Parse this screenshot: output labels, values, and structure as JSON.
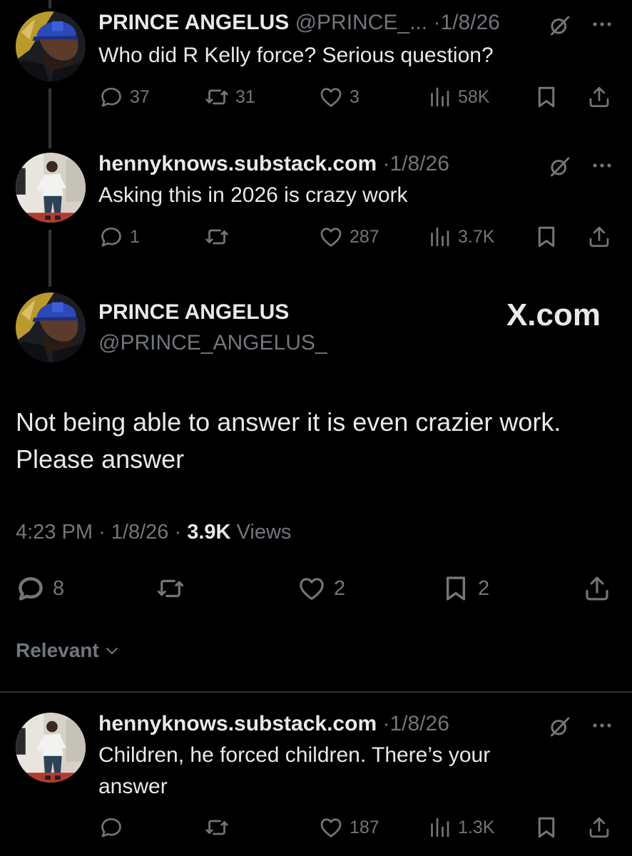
{
  "tweets": [
    {
      "name": "PRINCE ANGELUS",
      "handle": "@PRINCE_...",
      "sep": "·",
      "date": "1/8/26",
      "text": "Who did R Kelly force? Serious question?",
      "replies": "37",
      "reposts": "31",
      "likes": "3",
      "views": "58K"
    },
    {
      "name": "hennyknows.substack.com",
      "sep": "·",
      "date": "1/8/26",
      "text": "Asking this in 2026 is crazy work",
      "replies": "1",
      "reposts": "",
      "likes": "287",
      "views": "3.7K"
    }
  ],
  "main": {
    "name": "PRINCE ANGELUS",
    "handle": "@PRINCE_ANGELUS_",
    "brand": "X.com",
    "text": "Not being able to answer it is even crazier work. Please answer",
    "time": "4:23 PM",
    "sep": "·",
    "date": "1/8/26",
    "views_count": "3.9K",
    "views_label": "Views",
    "replies": "8",
    "reposts": "",
    "likes": "2",
    "bookmarks": "2"
  },
  "sort": {
    "label": "Relevant"
  },
  "reply": {
    "name": "hennyknows.substack.com",
    "sep": "·",
    "date": "1/8/26",
    "text": "Children, he forced children. There’s your answer",
    "replies": "",
    "reposts": "",
    "likes": "187",
    "views": "1.3K"
  },
  "icons": [
    "reply-icon",
    "repost-icon",
    "like-icon",
    "views-icon",
    "bookmark-icon",
    "share-icon",
    "grok-icon",
    "more-icon",
    "chevron-down-icon"
  ],
  "colors": {
    "background": "#000000",
    "text": "#e7e9ea",
    "muted": "#71767b",
    "divider": "#2f3336"
  }
}
